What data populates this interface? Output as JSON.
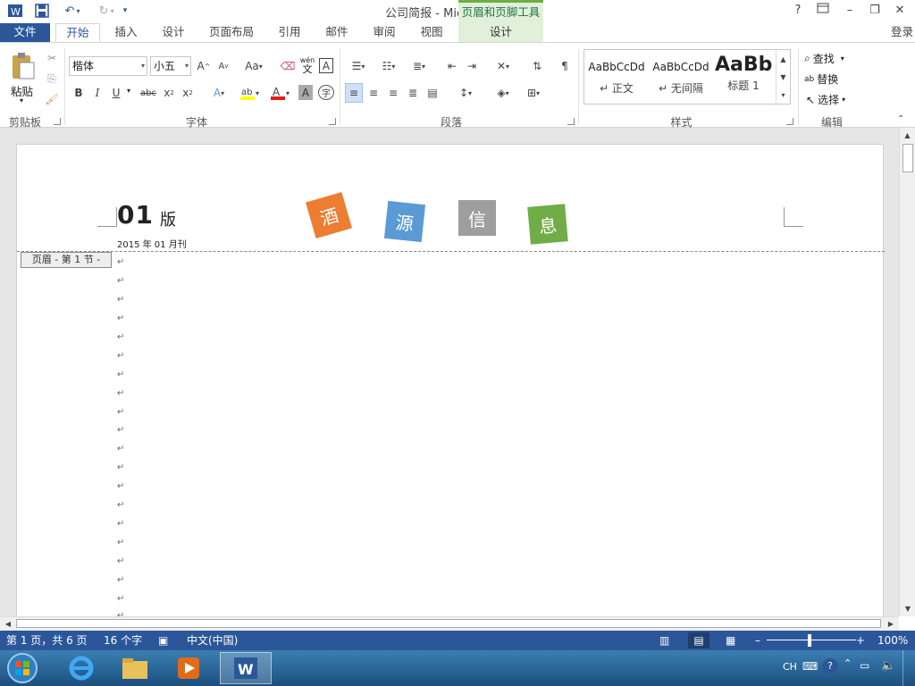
{
  "title": "公司简报 - Microsoft Word",
  "context_tab_group": "页眉和页脚工具",
  "login": "登录",
  "tabs": {
    "file": "文件",
    "home": "开始",
    "insert": "插入",
    "design": "设计",
    "layout": "页面布局",
    "references": "引用",
    "mailings": "邮件",
    "review": "审阅",
    "view": "视图",
    "ctx_design": "设计"
  },
  "ribbon": {
    "clipboard": {
      "label": "剪贴板",
      "paste": "粘贴"
    },
    "font": {
      "label": "字体",
      "font_name": "楷体",
      "font_size": "小五",
      "bold": "B",
      "italic": "I",
      "underline": "U",
      "strike": "abc",
      "grow": "A",
      "shrink": "A",
      "change_case": "Aa",
      "phonetic": "wén",
      "phonetic_char": "文",
      "border_char": "A",
      "enclose_char": "字"
    },
    "paragraph": {
      "label": "段落"
    },
    "styles": {
      "label": "样式",
      "items": [
        {
          "sample": "AaBbCcDd",
          "name": "↵ 正文"
        },
        {
          "sample": "AaBbCcDd",
          "name": "↵ 无间隔"
        },
        {
          "sample": "AaBb",
          "name": "标题 1"
        }
      ]
    },
    "editing": {
      "label": "编辑",
      "find": "查找",
      "replace": "替换",
      "select": "选择"
    }
  },
  "document": {
    "issue": "01",
    "issue_suffix": "版",
    "date_line": "2015 年 01 月刊",
    "header_tag": "页眉 - 第 1 节 -",
    "title_chars": [
      {
        "char": "酒",
        "color": "#ed7d31"
      },
      {
        "char": "源",
        "color": "#5b9bd5"
      },
      {
        "char": "信",
        "color": "#9e9e9e"
      },
      {
        "char": "息",
        "color": "#70ad47"
      }
    ],
    "para_mark": "↵"
  },
  "status": {
    "page": "第 1 页，共 6 页",
    "words": "16 个字",
    "language": "中文(中国)",
    "zoom": "100%"
  },
  "taskbar": {
    "ime": "CH"
  }
}
